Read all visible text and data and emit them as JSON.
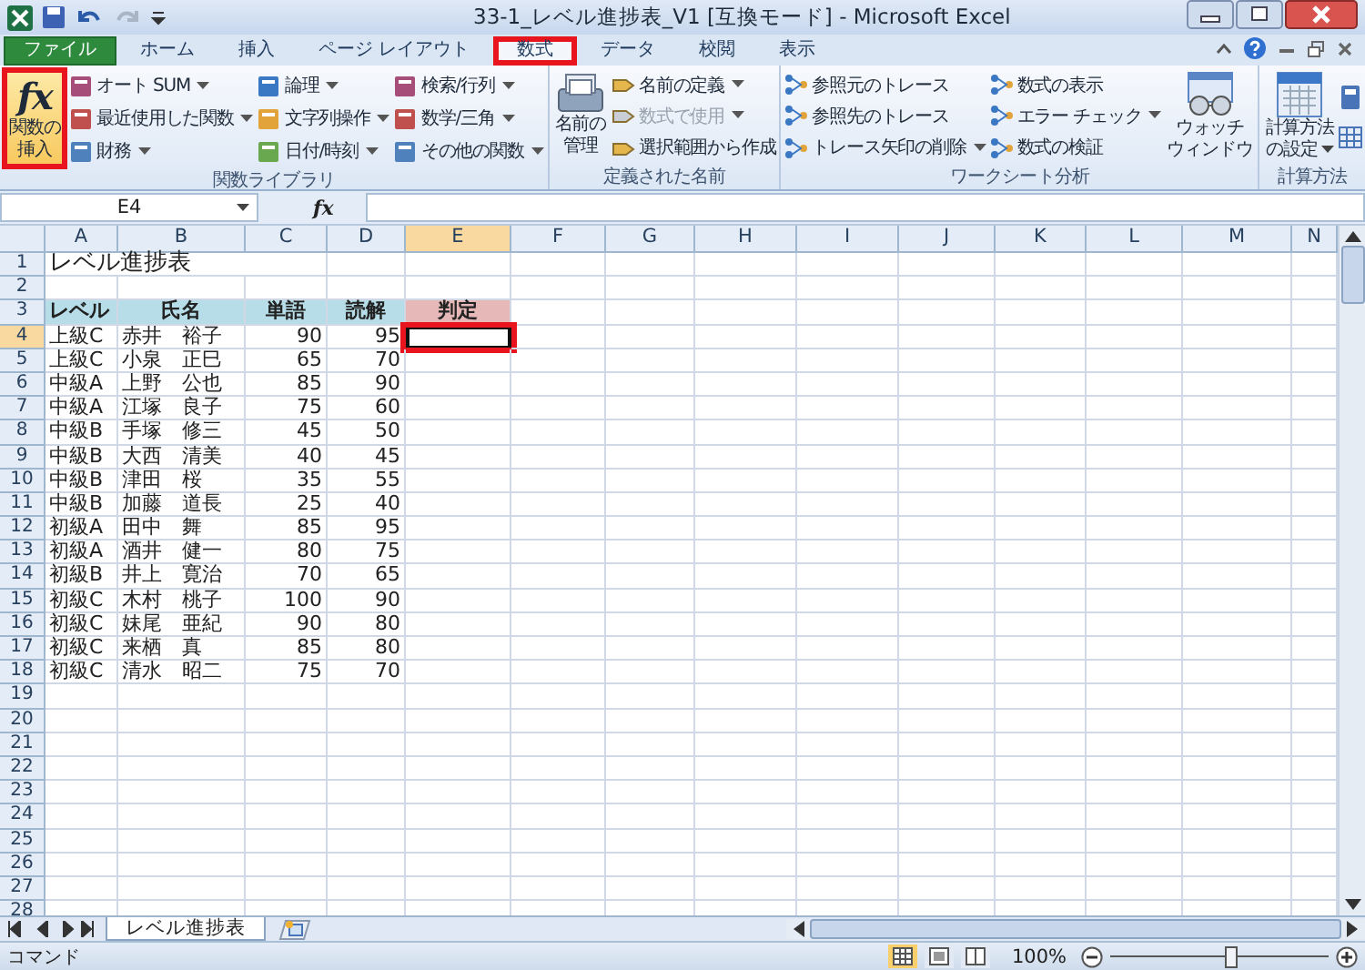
{
  "window": {
    "title": "33-1_レベル進捗表_V1  [互換モード] - Microsoft Excel"
  },
  "tabs": [
    {
      "label": "ファイル",
      "kind": "file",
      "selected": false,
      "highlighted": false
    },
    {
      "label": "ホーム",
      "kind": "tab",
      "selected": false,
      "highlighted": false
    },
    {
      "label": "挿入",
      "kind": "tab",
      "selected": false,
      "highlighted": false
    },
    {
      "label": "ページ レイアウト",
      "kind": "tab",
      "selected": false,
      "highlighted": false
    },
    {
      "label": "数式",
      "kind": "tab",
      "selected": true,
      "highlighted": true
    },
    {
      "label": "データ",
      "kind": "tab",
      "selected": false,
      "highlighted": false
    },
    {
      "label": "校閲",
      "kind": "tab",
      "selected": false,
      "highlighted": false
    },
    {
      "label": "表示",
      "kind": "tab",
      "selected": false,
      "highlighted": false
    }
  ],
  "ribbon": {
    "groups": [
      {
        "label": "関数ライブラリ",
        "kind": "functions",
        "columns": [
          {
            "kind": "large",
            "lines": [
              "関数の",
              "挿入"
            ],
            "icon_text": "fx",
            "highlighted": true,
            "dropdown": false
          },
          {
            "kind": "stack",
            "items": [
              {
                "label": "オート SUM",
                "dropdown": true,
                "disabled": false
              },
              {
                "label": "最近使用した関数",
                "dropdown": true,
                "disabled": false
              },
              {
                "label": "財務",
                "dropdown": true,
                "disabled": false
              }
            ]
          },
          {
            "kind": "stack",
            "items": [
              {
                "label": "論理",
                "dropdown": true,
                "disabled": false
              },
              {
                "label": "文字列操作",
                "dropdown": true,
                "disabled": false
              },
              {
                "label": "日付/時刻",
                "dropdown": true,
                "disabled": false
              }
            ]
          },
          {
            "kind": "stack",
            "items": [
              {
                "label": "検索/行列",
                "dropdown": true,
                "disabled": false
              },
              {
                "label": "数学/三角",
                "dropdown": true,
                "disabled": false
              },
              {
                "label": "その他の関数",
                "dropdown": true,
                "disabled": false
              }
            ]
          }
        ]
      },
      {
        "label": "定義された名前",
        "kind": "names",
        "columns": [
          {
            "kind": "large",
            "lines": [
              "名前の",
              "管理"
            ],
            "highlighted": false,
            "dropdown": false
          },
          {
            "kind": "stack",
            "items": [
              {
                "label": "名前の定義",
                "dropdown": true,
                "disabled": false
              },
              {
                "label": "数式で使用",
                "dropdown": true,
                "disabled": true
              },
              {
                "label": "選択範囲から作成",
                "dropdown": false,
                "disabled": false
              }
            ]
          }
        ]
      },
      {
        "label": "ワークシート分析",
        "kind": "audit",
        "columns": [
          {
            "kind": "stack",
            "items": [
              {
                "label": "参照元のトレース",
                "dropdown": false,
                "disabled": false
              },
              {
                "label": "参照先のトレース",
                "dropdown": false,
                "disabled": false
              },
              {
                "label": "トレース矢印の削除",
                "dropdown": true,
                "disabled": false
              }
            ]
          },
          {
            "kind": "stack",
            "items": [
              {
                "label": "数式の表示",
                "dropdown": false,
                "disabled": false
              },
              {
                "label": "エラー チェック",
                "dropdown": true,
                "disabled": false
              },
              {
                "label": "数式の検証",
                "dropdown": false,
                "disabled": false
              }
            ]
          },
          {
            "kind": "large",
            "lines": [
              "ウォッチ",
              "ウィンドウ"
            ],
            "highlighted": false,
            "dropdown": false
          }
        ]
      },
      {
        "label": "計算方法",
        "kind": "calc",
        "columns": [
          {
            "kind": "large",
            "lines": [
              "計算方法",
              "の設定"
            ],
            "highlighted": false,
            "dropdown": true
          }
        ]
      }
    ]
  },
  "formula_bar": {
    "name_box": "E4",
    "fx_label": "fx"
  },
  "sheet": {
    "columns": [
      {
        "label": "A",
        "selected": false
      },
      {
        "label": "B",
        "selected": false
      },
      {
        "label": "C",
        "selected": false
      },
      {
        "label": "D",
        "selected": false
      },
      {
        "label": "E",
        "selected": true
      },
      {
        "label": "F",
        "selected": false
      },
      {
        "label": "G",
        "selected": false
      },
      {
        "label": "H",
        "selected": false
      },
      {
        "label": "I",
        "selected": false
      },
      {
        "label": "J",
        "selected": false
      },
      {
        "label": "K",
        "selected": false
      },
      {
        "label": "L",
        "selected": false
      },
      {
        "label": "M",
        "selected": false
      },
      {
        "label": "N",
        "selected": false
      }
    ],
    "rows": [
      {
        "number": "1",
        "kind": "title",
        "selected": false,
        "cells": [
          "レベル進捗表"
        ]
      },
      {
        "number": "2",
        "kind": "blank",
        "selected": false
      },
      {
        "number": "3",
        "kind": "header",
        "selected": false,
        "cells": [
          {
            "text": "レベル",
            "color": "#b7dee8"
          },
          {
            "text": "氏名",
            "color": "#b7dee8"
          },
          {
            "text": "単語",
            "color": "#b7dee8"
          },
          {
            "text": "読解",
            "color": "#b7dee8"
          },
          {
            "text": "判定",
            "color": "#e6b8b7"
          }
        ]
      },
      {
        "number": "4",
        "kind": "data",
        "selected": true,
        "highlighted": true,
        "cells": [
          "上級C",
          "赤井　裕子",
          "90",
          "95"
        ]
      },
      {
        "number": "5",
        "kind": "data",
        "selected": false,
        "highlighted": false,
        "cells": [
          "上級C",
          "小泉　正巳",
          "65",
          "70"
        ]
      },
      {
        "number": "6",
        "kind": "data",
        "selected": false,
        "highlighted": false,
        "cells": [
          "中級A",
          "上野　公也",
          "85",
          "90"
        ]
      },
      {
        "number": "7",
        "kind": "data",
        "selected": false,
        "highlighted": false,
        "cells": [
          "中級A",
          "江塚　良子",
          "75",
          "60"
        ]
      },
      {
        "number": "8",
        "kind": "data",
        "selected": false,
        "highlighted": false,
        "cells": [
          "中級B",
          "手塚　修三",
          "45",
          "50"
        ]
      },
      {
        "number": "9",
        "kind": "data",
        "selected": false,
        "highlighted": false,
        "cells": [
          "中級B",
          "大西　清美",
          "40",
          "45"
        ]
      },
      {
        "number": "10",
        "kind": "data",
        "selected": false,
        "highlighted": false,
        "cells": [
          "中級B",
          "津田　桜",
          "35",
          "55"
        ]
      },
      {
        "number": "11",
        "kind": "data",
        "selected": false,
        "highlighted": false,
        "cells": [
          "中級B",
          "加藤　道長",
          "25",
          "40"
        ]
      },
      {
        "number": "12",
        "kind": "data",
        "selected": false,
        "highlighted": false,
        "cells": [
          "初級A",
          "田中　舞",
          "85",
          "95"
        ]
      },
      {
        "number": "13",
        "kind": "data",
        "selected": false,
        "highlighted": false,
        "cells": [
          "初級A",
          "酒井　健一",
          "80",
          "75"
        ]
      },
      {
        "number": "14",
        "kind": "data",
        "selected": false,
        "highlighted": false,
        "cells": [
          "初級B",
          "井上　寛治",
          "70",
          "65"
        ]
      },
      {
        "number": "15",
        "kind": "data",
        "selected": false,
        "highlighted": false,
        "cells": [
          "初級C",
          "木村　桃子",
          "100",
          "90"
        ]
      },
      {
        "number": "16",
        "kind": "data",
        "selected": false,
        "highlighted": false,
        "cells": [
          "初級C",
          "妹尾　亜紀",
          "90",
          "80"
        ]
      },
      {
        "number": "17",
        "kind": "data",
        "selected": false,
        "highlighted": false,
        "cells": [
          "初級C",
          "来栖　真",
          "85",
          "80"
        ]
      },
      {
        "number": "18",
        "kind": "data",
        "selected": false,
        "highlighted": false,
        "cells": [
          "初級C",
          "清水　昭二",
          "75",
          "70"
        ]
      },
      {
        "number": "19",
        "kind": "blank",
        "selected": false
      },
      {
        "number": "20",
        "kind": "blank",
        "selected": false
      },
      {
        "number": "21",
        "kind": "blank",
        "selected": false
      },
      {
        "number": "22",
        "kind": "blank",
        "selected": false
      },
      {
        "number": "23",
        "kind": "blank",
        "selected": false
      },
      {
        "number": "24",
        "kind": "blank",
        "selected": false
      },
      {
        "number": "25",
        "kind": "blank",
        "selected": false
      },
      {
        "number": "26",
        "kind": "blank",
        "selected": false
      },
      {
        "number": "27",
        "kind": "blank",
        "selected": false
      },
      {
        "number": "28",
        "kind": "blank",
        "selected": false
      }
    ]
  },
  "sheet_tabs": [
    {
      "label": "レベル進捗表",
      "selected": true
    }
  ],
  "status_bar": {
    "mode": "コマンド",
    "views": [
      {
        "kind": "normal",
        "selected": true
      },
      {
        "kind": "page_layout",
        "selected": false
      },
      {
        "kind": "page_break",
        "selected": false
      }
    ],
    "zoom": {
      "label": "100%",
      "level": 0.55
    }
  }
}
